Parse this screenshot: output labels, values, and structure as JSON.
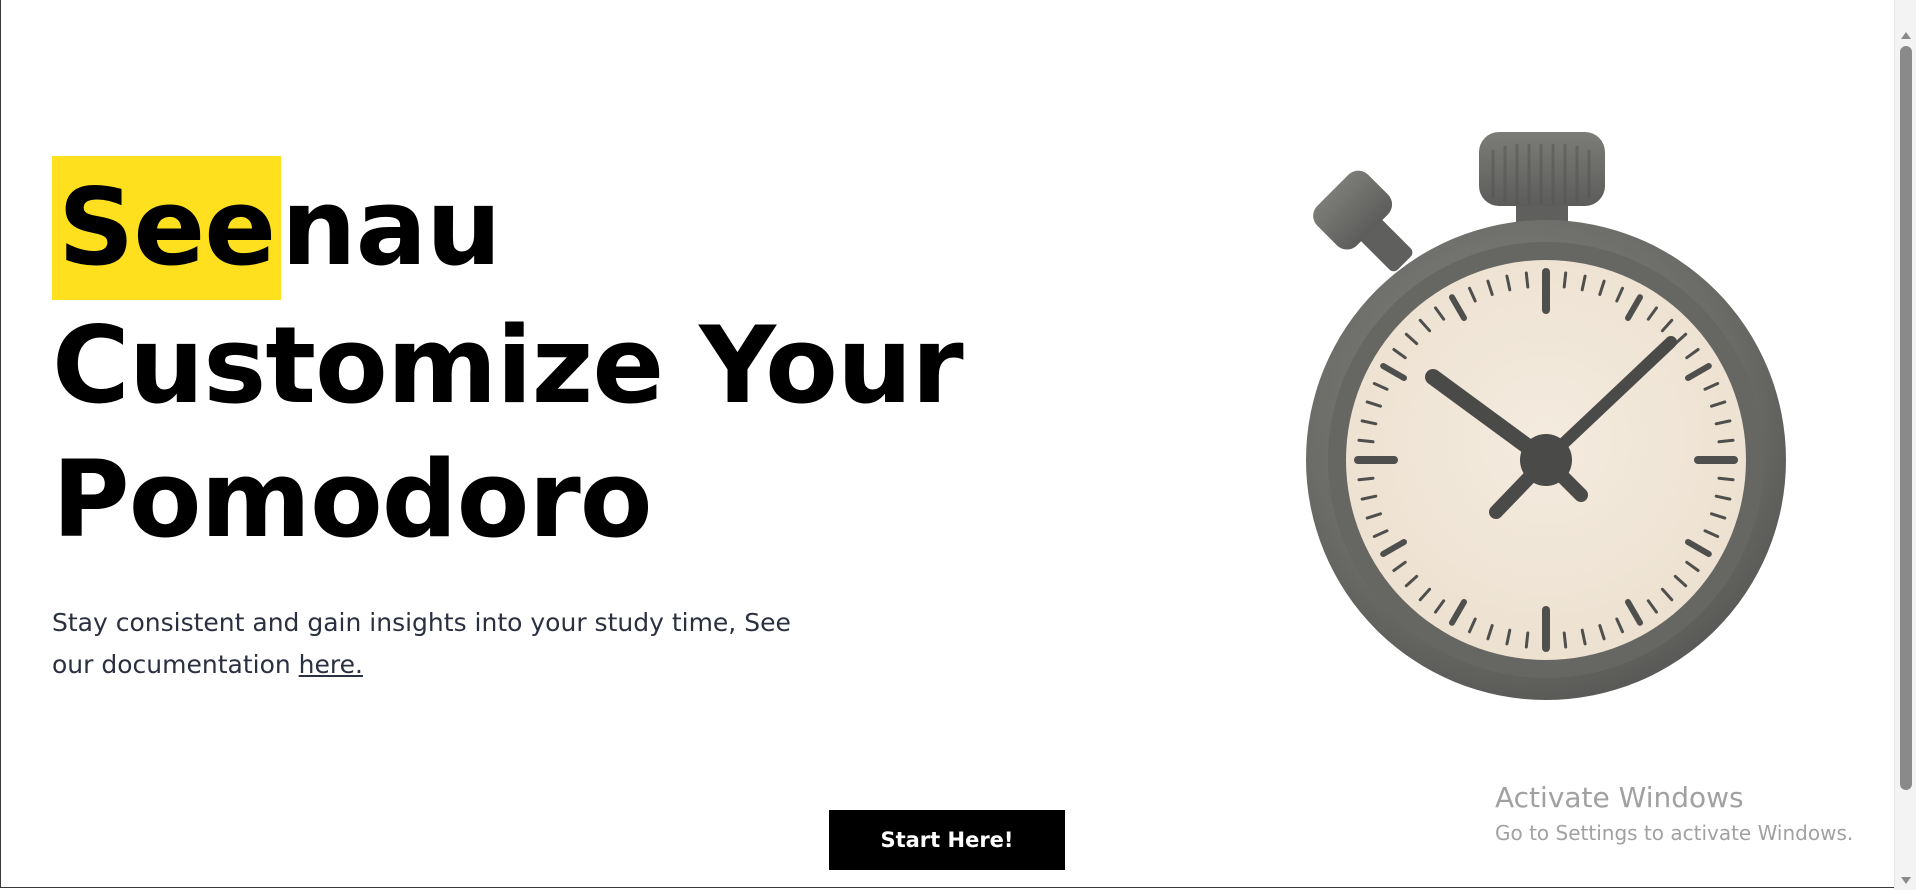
{
  "hero": {
    "brand_highlight": "See",
    "brand_rest": "nau",
    "headline_line1": "Customize Your",
    "headline_line2": "Pomodoro",
    "subtitle_text": "Stay consistent and gain insights into your study time, See our documentation",
    "subtitle_link": "here."
  },
  "cta": {
    "label": "Start Here!"
  },
  "watermark": {
    "title": "Activate Windows",
    "subtitle": "Go to Settings to activate Windows."
  },
  "illustration": {
    "icon": "stopwatch-icon"
  },
  "colors": {
    "highlight": "#ffe01f",
    "cta_background": "#000000",
    "text": "#000000",
    "subtitle": "#2b3040",
    "dial_face": "#f1e6d8",
    "case": "#6f6f6c"
  }
}
